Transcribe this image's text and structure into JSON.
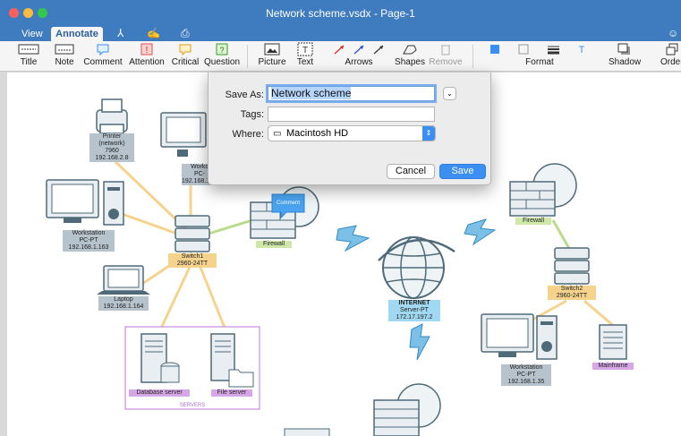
{
  "window": {
    "title": "Network scheme.vsdx - Page-1"
  },
  "tabs": {
    "view": "View",
    "annotate": "Annotate"
  },
  "ribbon": {
    "title": "Title",
    "note": "Note",
    "comment": "Comment",
    "attention": "Attention",
    "critical": "Critical",
    "question": "Question",
    "picture": "Picture",
    "text": "Text",
    "arrows": "Arrows",
    "shapes": "Shapes",
    "remove": "Remove",
    "format": "Format",
    "shadow": "Shadow",
    "order": "Order"
  },
  "dialog": {
    "save_as_label": "Save As:",
    "save_as_value": "Network scheme",
    "tags_label": "Tags:",
    "tags_value": "",
    "where_label": "Where:",
    "where_value": "Macintosh HD",
    "cancel": "Cancel",
    "save": "Save"
  },
  "diagram": {
    "printer": {
      "name": "Printer",
      "type": "(network)",
      "model": "7960",
      "ip": "192.168.2.8"
    },
    "workstation_top": {
      "name": "Works",
      "model": "PC-",
      "ip": "192.168.1.162"
    },
    "workstation_left": {
      "name": "Workstation",
      "model": "PC-PT",
      "ip": "192.168.1.163"
    },
    "switch1": {
      "name": "Switch1",
      "model": "2960-24TT"
    },
    "laptop": {
      "name": "Laptop",
      "ip": "192.168.1.164"
    },
    "firewall_left": {
      "name": "Firewall"
    },
    "comment_note": "Comment",
    "internet": {
      "name": "INTERNET",
      "model": "Server-PT",
      "ip": "172.17.197.2"
    },
    "firewall_right": {
      "name": "Firewall"
    },
    "switch2": {
      "name": "Switch2",
      "model": "2960-24TT"
    },
    "workstation_right": {
      "name": "Workstation",
      "model": "PC-PT",
      "ip": "192.168.1.35"
    },
    "mainframe": {
      "name": "Mainframe"
    },
    "database_server": {
      "name": "Database server"
    },
    "file_server": {
      "name": "File server"
    },
    "servers_group": "SERVERS"
  },
  "colors": {
    "titlebar": "#3f7cbf",
    "accent": "#3b8ff3",
    "link_yellow": "#f6d38d",
    "link_green": "#b9dc8c"
  }
}
